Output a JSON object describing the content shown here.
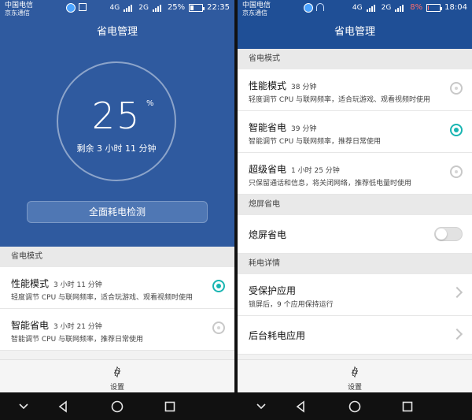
{
  "left": {
    "status": {
      "carrier_1": "中国电信",
      "carrier_2": "京东通信",
      "net_1": "4G",
      "net_2": "2G",
      "battery_pct": "25%",
      "battery_level": 0.25,
      "time": "22:35"
    },
    "header_title": "省电管理",
    "hero": {
      "percent": "25",
      "percent_sign": "%",
      "remaining": "剩余 3 小时 11 分钟",
      "scan_button": "全面耗电检测"
    },
    "section_mode": "省电模式",
    "modes": [
      {
        "title": "性能模式",
        "time": "3 小时 11 分钟",
        "desc": "轻度调节 CPU 与联网频率，适合玩游戏、观看视频时使用",
        "selected": true
      },
      {
        "title": "智能省电",
        "time": "3 小时 21 分钟",
        "desc": "智能调节 CPU 与联网频率，推荐日常使用",
        "selected": false
      }
    ],
    "settings_label": "设置"
  },
  "right": {
    "status": {
      "carrier_1": "中国电信",
      "carrier_2": "京东通信",
      "net_1": "4G",
      "net_2": "2G",
      "battery_pct": "8%",
      "battery_level": 0.08,
      "time": "18:04"
    },
    "header_title": "省电管理",
    "section_mode": "省电模式",
    "modes": [
      {
        "title": "性能模式",
        "time": "38 分钟",
        "desc": "轻度调节 CPU 与联网频率，适合玩游戏、观看视频时使用",
        "selected": false
      },
      {
        "title": "智能省电",
        "time": "39 分钟",
        "desc": "智能调节 CPU 与联网频率，推荐日常使用",
        "selected": true
      },
      {
        "title": "超级省电",
        "time": "1 小时 25 分钟",
        "desc": "只保留通话和信息，将关闭网络，推荐低电量时使用",
        "selected": false
      }
    ],
    "section_screen_off": "熄屏省电",
    "screen_off_label": "熄屏省电",
    "screen_off_enabled": false,
    "section_details": "耗电详情",
    "protected_apps_title": "受保护应用",
    "protected_apps_sub": "锁屏后，9 个应用保持运行",
    "background_apps_title": "后台耗电应用",
    "settings_label": "设置"
  },
  "colors": {
    "primary_blue": "#2f5a9f",
    "accent_teal": "#19b5b2"
  }
}
